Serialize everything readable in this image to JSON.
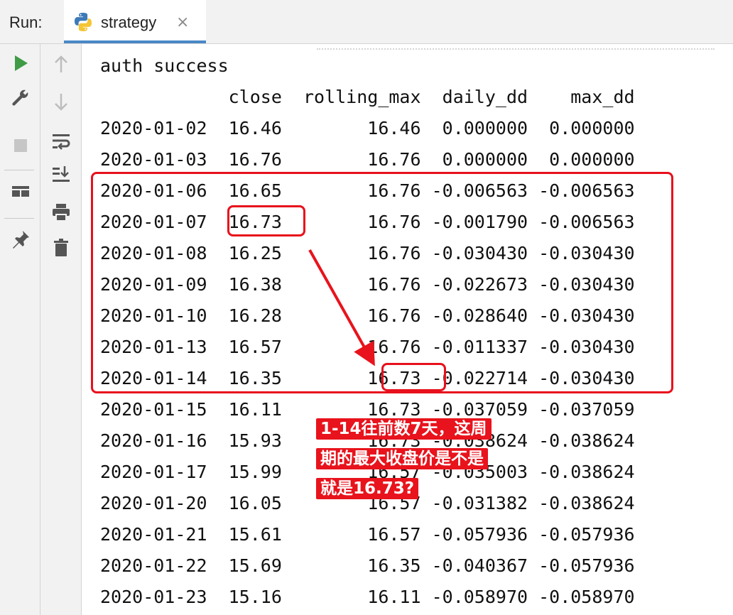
{
  "run_bar": {
    "label": "Run:",
    "tab": {
      "name": "strategy",
      "icon": "python-icon",
      "close": "×"
    }
  },
  "left_toolbar": {
    "primary_icons": [
      "run-icon",
      "wrench-icon",
      "stop-icon",
      "layout-icon",
      "pin-icon"
    ],
    "secondary_icons": [
      "arrow-up-icon",
      "arrow-down-icon",
      "soft-wrap-icon",
      "scroll-to-end-icon",
      "print-icon",
      "trash-icon"
    ]
  },
  "console": {
    "auth_line": "auth success",
    "header": "            close  rolling_max  daily_dd    max_dd",
    "rows": [
      "2020-01-02  16.46        16.46  0.000000  0.000000",
      "2020-01-03  16.76        16.76  0.000000  0.000000",
      "2020-01-06  16.65        16.76 -0.006563 -0.006563",
      "2020-01-07  16.73        16.76 -0.001790 -0.006563",
      "2020-01-08  16.25        16.76 -0.030430 -0.030430",
      "2020-01-09  16.38        16.76 -0.022673 -0.030430",
      "2020-01-10  16.28        16.76 -0.028640 -0.030430",
      "2020-01-13  16.57        16.76 -0.011337 -0.030430",
      "2020-01-14  16.35        16.73 -0.022714 -0.030430",
      "2020-01-15  16.11        16.73 -0.037059 -0.037059",
      "2020-01-16  15.93        16.73 -0.038624 -0.038624",
      "2020-01-17  15.99        16.57 -0.035003 -0.038624",
      "2020-01-20  16.05        16.57 -0.031382 -0.038624",
      "2020-01-21  15.61        16.57 -0.057936 -0.057936",
      "2020-01-22  15.69        16.35 -0.040367 -0.057936",
      "2020-01-23  15.16        16.11 -0.058970 -0.058970"
    ]
  },
  "annotation": {
    "note_lines": [
      "1-14往前数7天，这周",
      "期的最大收盘价是不是",
      "就是16.73?"
    ],
    "color": "#e8131c"
  }
}
